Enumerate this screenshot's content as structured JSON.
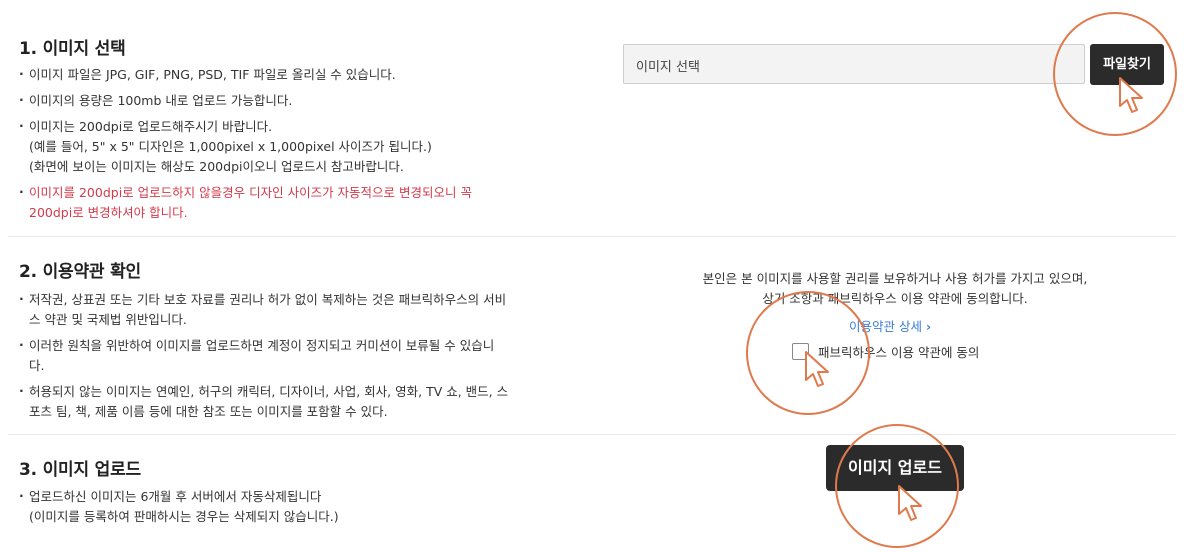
{
  "section1": {
    "title": "1. 이미지 선택",
    "notes": [
      "이미지 파일은 JPG, GIF, PNG, PSD, TIF 파일로 올리실 수 있습니다.",
      "이미지의 용량은 100mb 내로 업로드 가능합니다.",
      "이미지는 200dpi로 업로드해주시기 바랍니다.\n(예를 들어, 5\" x 5\" 디자인은 1,000pixel x 1,000pixel 사이즈가 됩니다.)\n(화면에 보이는 이미지는 해상도 200dpi이오니 업로드시 참고바랍니다.",
      "이미지를 200dpi로 업로드하지 않을경우 디자인 사이즈가 자동적으로 변경되오니 꼭\n200dpi로 변경하셔야 합니다."
    ],
    "file_placeholder": "이미지 선택",
    "find_button": "파일찾기"
  },
  "section2": {
    "title": "2. 이용약관 확인",
    "notes": [
      "저작권, 상표권 또는 기타 보호 자료를 권리나 허가 없이 복제하는 것은 패브릭하우스의 서비\n스 약관 및 국제법 위반입니다.",
      "이러한 원칙을 위반하여 이미지를 업로드하면 계정이 정지되고 커미션이 보류될 수 있습니\n다.",
      "허용되지 않는 이미지는 연예인, 허구의 캐릭터, 디자이너, 사업, 회사, 영화, TV 쇼, 밴드, 스\n포츠 팀, 책, 제품 이름 등에 대한 참조 또는 이미지를 포함할 수 있다."
    ],
    "agreement_text": "본인은 본 이미지를 사용할 권리를 보유하거나 사용 허가를 가지고 있으며,\n상기 조항과 패브릭하우스 이용 약관에 동의합니다.",
    "terms_link": "이용약관 상세",
    "terms_link_icon": "chevron-right-icon",
    "agree_label": "패브릭하우스 이용 약관에 동의",
    "agree_checked": false
  },
  "section3": {
    "title": "3. 이미지 업로드",
    "notes": [
      "업로드하신 이미지는 6개월 후 서버에서 자동삭제됩니다\n(이미지를 등록하여 판매하시는 경우는 삭제되지 않습니다.)"
    ],
    "upload_button": "이미지 업로드"
  },
  "colors": {
    "highlight_circle": "#e07a4c",
    "warning_text": "#d43a4b",
    "link": "#3b7dd0",
    "button_dark": "#2b2b2b"
  }
}
